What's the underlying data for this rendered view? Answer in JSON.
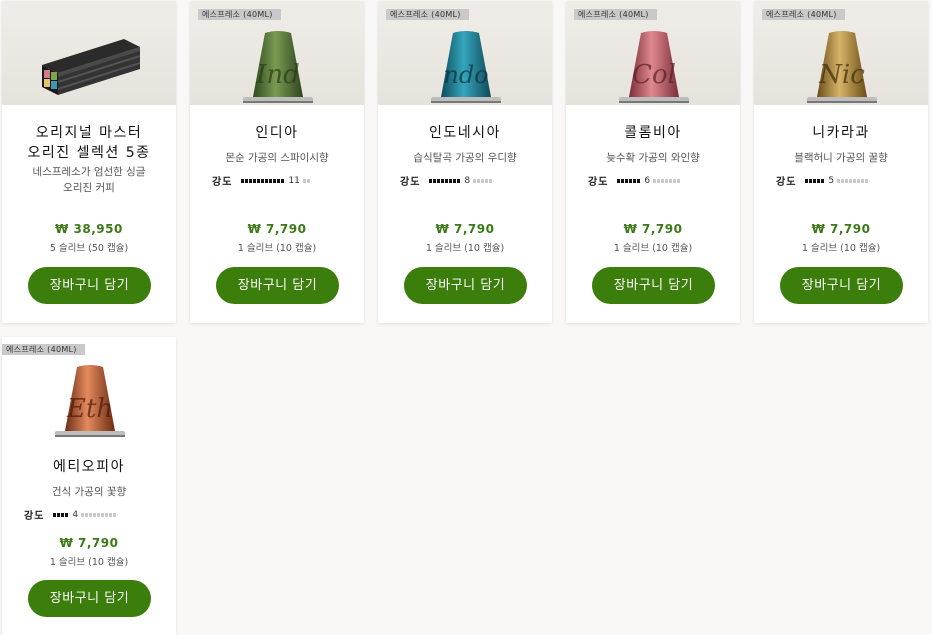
{
  "products": [
    {
      "id": "master-origins",
      "badge": "",
      "title_line1": "오리지널 마스터",
      "title_line2": "오리진 셀렉션 5종",
      "desc_line1": "네스프레소가 엄선한 싱글",
      "desc_line2": "오리진 커피",
      "intensity_label": "",
      "intensity": "",
      "price": "₩ 38,950",
      "sleeves": "5 슬리브 (50 캡슐)",
      "cart_label": "장바구니 담기"
    },
    {
      "id": "india",
      "badge": "에스프레소 (40ML)",
      "title_line1": "인디아",
      "desc_line1": "몬순 가공의 스파이시향",
      "intensity_label": "강도",
      "intensity": "11",
      "intensity_value": 11,
      "price": "₩ 7,790",
      "sleeves": "1 슬리브 (10 캡슐)",
      "cart_label": "장바구니 담기",
      "capsule_color": "#5b7a3a",
      "capsule_text": "Ind"
    },
    {
      "id": "indonesia",
      "badge": "에스프레소 (40ML)",
      "title_line1": "인도네시아",
      "desc_line1": "습식탈곡 가공의 우디향",
      "intensity_label": "강도",
      "intensity": "8",
      "intensity_value": 8,
      "price": "₩ 7,790",
      "sleeves": "1 슬리브 (10 캡슐)",
      "cart_label": "장바구니 담기",
      "capsule_color": "#1f7f92",
      "capsule_text": "Indo"
    },
    {
      "id": "colombia",
      "badge": "에스프레소 (40ML)",
      "title_line1": "콜롬비아",
      "desc_line1": "늦수확 가공의 와인향",
      "intensity_label": "강도",
      "intensity": "6",
      "intensity_value": 6,
      "price": "₩ 7,790",
      "sleeves": "1 슬리브 (10 캡슐)",
      "cart_label": "장바구니 담기",
      "capsule_color": "#c96a72",
      "capsule_text": "Col"
    },
    {
      "id": "nicaragua",
      "badge": "에스프레소 (40ML)",
      "title_line1": "니카라과",
      "desc_line1": "블랙허니 가공의 꿀향",
      "intensity_label": "강도",
      "intensity": "5",
      "intensity_value": 5,
      "price": "₩ 7,790",
      "sleeves": "1 슬리브 (10 캡슐)",
      "cart_label": "장바구니 담기",
      "capsule_color": "#b08a3a",
      "capsule_text": "Nic"
    },
    {
      "id": "ethiopia",
      "badge": "에스프레소 (40ML)",
      "title_line1": "에티오피아",
      "desc_line1": "건식 가공의 꽃향",
      "intensity_label": "강도",
      "intensity": "4",
      "intensity_value": 4,
      "price": "₩ 7,790",
      "sleeves": "1 슬리브 (10 캡슐)",
      "cart_label": "장바구니 담기",
      "capsule_color": "#c0633a",
      "capsule_text": "Eth"
    }
  ],
  "colors": {
    "accent_green": "#3b7e0c",
    "price_green": "#3b7a17",
    "intensity_on": "#111111",
    "intensity_off": "#c9c9c9"
  },
  "intensity_max": 13
}
